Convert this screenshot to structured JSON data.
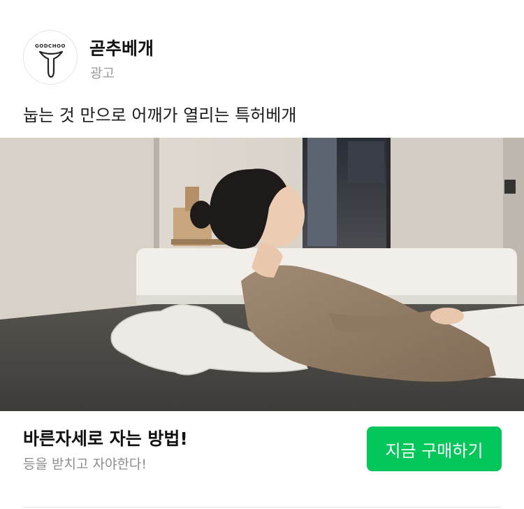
{
  "advertiser": {
    "logo_text": "GODCHOO",
    "name": "곧추베개",
    "sponsored_label": "광고"
  },
  "ad": {
    "headline": "눕는 것 만으로 어깨가 열리는 특허베개",
    "photo_icon": "woman-lying-on-pillow-photo"
  },
  "footer": {
    "title": "바른자세로 자는 방법!",
    "subtitle": "등을 받치고 자야한다!",
    "cta_label": "지금 구매하기"
  },
  "colors": {
    "cta_background": "#03c75a",
    "cta_text": "#ffffff",
    "sponsored_text": "#9a9a9a",
    "subtitle_text": "#8c8c8c"
  }
}
